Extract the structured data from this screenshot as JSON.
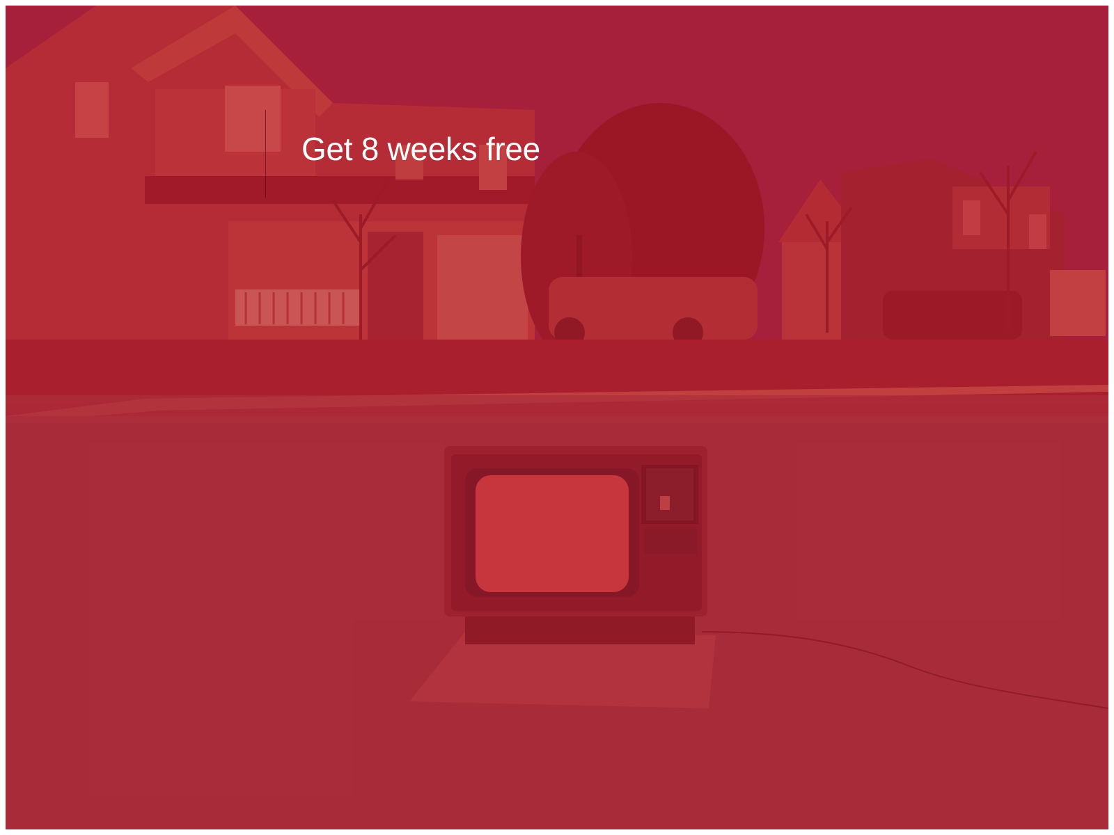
{
  "hero": {
    "headline": "Get 8 weeks free",
    "overlay_color": "#a81d2c",
    "headline_color": "#ffffff",
    "image": "suburban street with a vintage television set on the road"
  }
}
